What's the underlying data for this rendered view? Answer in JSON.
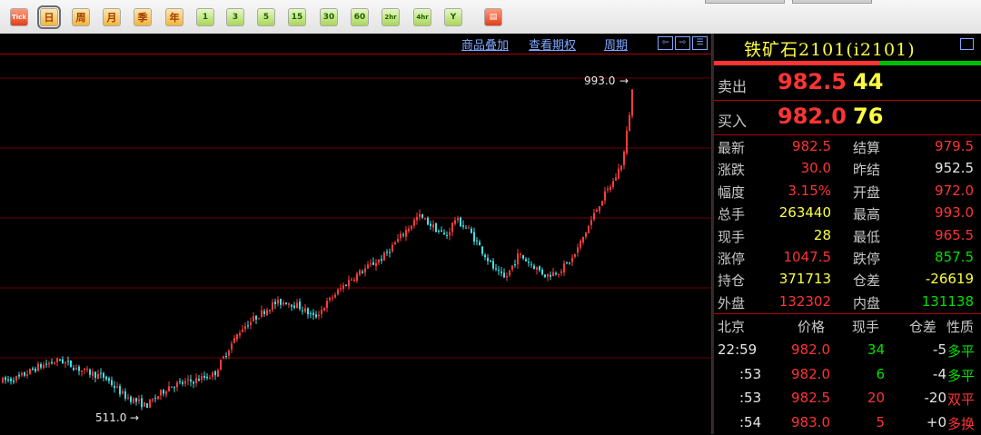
{
  "toolbar": {
    "buttons": [
      {
        "label": "Tick"
      },
      {
        "label": "日"
      },
      {
        "label": "周"
      },
      {
        "label": "月"
      },
      {
        "label": "季"
      },
      {
        "label": "年"
      },
      {
        "label": "1"
      },
      {
        "label": "3"
      },
      {
        "label": "5"
      },
      {
        "label": "15"
      },
      {
        "label": "30"
      },
      {
        "label": "60"
      },
      {
        "label": "2hr"
      },
      {
        "label": "4hr"
      },
      {
        "label": "Y"
      },
      {
        "label": "▤"
      }
    ]
  },
  "chart_header": {
    "links": [
      "商品叠加",
      "查看期权",
      "周期"
    ],
    "nav": [
      "⇦",
      "⇨",
      "☰"
    ]
  },
  "chart": {
    "high_label": "993.0",
    "low_label": "511.0",
    "up_color": "#ff3b3b",
    "down_color": "#3fe0e6"
  },
  "chart_data": {
    "type": "candlestick",
    "ylim": [
      480,
      1020
    ],
    "high": 993.0,
    "low": 511.0
  },
  "quote": {
    "title": "铁矿石2101(i2101)",
    "sell": {
      "label": "卖出",
      "price": "982.5",
      "vol": "44"
    },
    "buy": {
      "label": "买入",
      "price": "982.0",
      "vol": "76"
    },
    "stats": [
      {
        "l1": "最新",
        "v1": "982.5",
        "c1": "red",
        "l2": "结算",
        "v2": "979.5",
        "c2": "red"
      },
      {
        "l1": "涨跌",
        "v1": "30.0",
        "c1": "red",
        "l2": "昨结",
        "v2": "952.5",
        "c2": "white"
      },
      {
        "l1": "幅度",
        "v1": "3.15%",
        "c1": "red",
        "l2": "开盘",
        "v2": "972.0",
        "c2": "red"
      },
      {
        "l1": "总手",
        "v1": "263440",
        "c1": "yellow",
        "l2": "最高",
        "v2": "993.0",
        "c2": "red"
      },
      {
        "l1": "现手",
        "v1": "28",
        "c1": "yellow",
        "l2": "最低",
        "v2": "965.5",
        "c2": "red"
      },
      {
        "l1": "涨停",
        "v1": "1047.5",
        "c1": "red",
        "l2": "跌停",
        "v2": "857.5",
        "c2": "green"
      },
      {
        "l1": "持仓",
        "v1": "371713",
        "c1": "yellow",
        "l2": "仓差",
        "v2": "-26619",
        "c2": "yellow"
      },
      {
        "l1": "外盘",
        "v1": "132302",
        "c1": "red",
        "l2": "内盘",
        "v2": "131138",
        "c2": "green"
      }
    ],
    "tick_header": [
      "北京",
      "价格",
      "现手",
      "仓差",
      "性质"
    ],
    "ticks": [
      {
        "time": "22:59",
        "price": "982.0",
        "vol": "34",
        "diff": "-5",
        "nature": "多平",
        "nc": "green",
        "tc": "white"
      },
      {
        "time": ":53",
        "price": "982.0",
        "vol": "6",
        "diff": "-4",
        "nature": "多平",
        "nc": "green",
        "tc": "white"
      },
      {
        "time": ":53",
        "price": "982.5",
        "vol": "20",
        "diff": "-20",
        "nature": "双平",
        "nc": "red",
        "tc": "white"
      },
      {
        "time": ":54",
        "price": "983.0",
        "vol": "5",
        "diff": "+0",
        "nature": "多换",
        "nc": "red",
        "tc": "white"
      }
    ]
  }
}
